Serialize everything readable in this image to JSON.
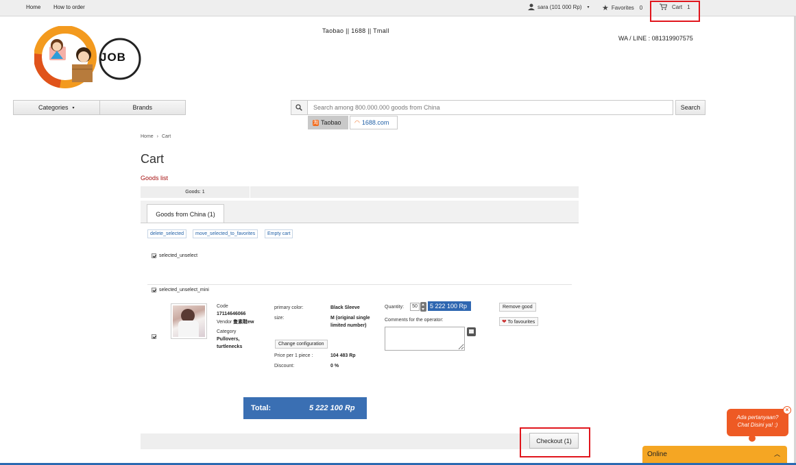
{
  "topbar": {
    "home": "Home",
    "how_to_order": "How to order",
    "user": "sara (101 000 Rp)",
    "favorites_label": "Favorites",
    "favorites_count": "0",
    "cart_label": "Cart",
    "cart_count": "1"
  },
  "header": {
    "tagline": "Taobao || 1688 || Tmall",
    "contact": "WA / LINE : 081319907575",
    "logo_text": "JOB"
  },
  "nav": {
    "categories": "Categories",
    "brands": "Brands"
  },
  "search": {
    "placeholder": "Search among 800.000.000 goods from China",
    "button": "Search",
    "sources": [
      "Taobao",
      "1688.com"
    ]
  },
  "breadcrumb": {
    "home": "Home",
    "current": "Cart"
  },
  "page": {
    "title": "Cart",
    "subtitle": "Goods list",
    "goods_count": "Goods: 1",
    "tab": "Goods from China (1)"
  },
  "actions": {
    "delete_selected": "delete_selected",
    "move_to_favorites": "move_selected_to_favorites",
    "empty_cart": "Empty cart"
  },
  "select_all": "selected_unselect",
  "select_mini": "selected_unselect_mini",
  "item": {
    "code_label": "Code",
    "code": "17114646066",
    "vendor_label": "Vendor",
    "vendor": "隻素鞋ew",
    "category_label": "Category",
    "category": "Pullovers, turtlenecks",
    "primary_color_label": "primary color:",
    "primary_color": "Black Sleeve",
    "size_label": "size:",
    "size": "M (original single limited number)",
    "change_config": "Change configuration",
    "price_label": "Price per 1 piece :",
    "price": "104 483 Rp",
    "discount_label": "Discount:",
    "discount": "0 %",
    "quantity_label": "Quantity:",
    "quantity": "50",
    "line_total": "5 222 100 Rp",
    "comments_label": "Comments for the operator:",
    "remove": "Remove good",
    "to_favourites": "To favourites"
  },
  "total": {
    "label": "Total:",
    "value": "5 222 100",
    "currency": "Rp"
  },
  "checkout": "Checkout (1)",
  "chat": {
    "line1": "Ada pertanyaan?",
    "line2": "Chat Disini ya! :)",
    "close": "×",
    "status": "Online"
  },
  "colors": {
    "accent_blue": "#2f67b1",
    "total_blue": "#3a6fb3",
    "highlight_red": "#e0141b",
    "chat_orange": "#ee5a24",
    "online_orange": "#f5a623",
    "goods_list_red": "#a50f0f"
  }
}
